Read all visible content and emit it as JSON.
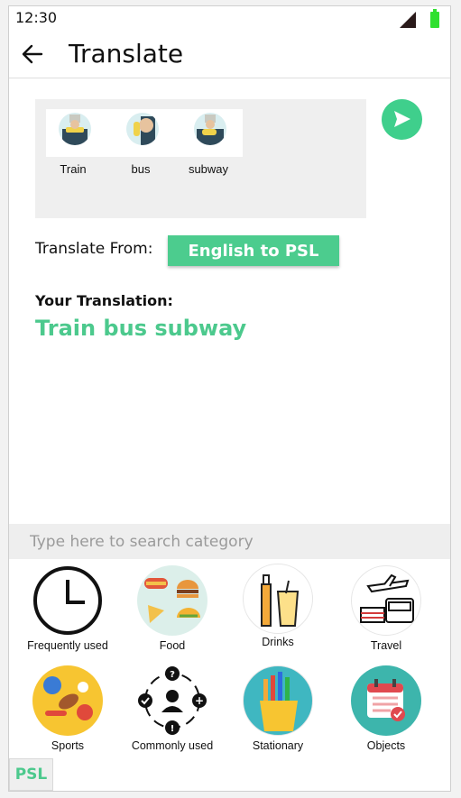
{
  "status_bar": {
    "time": "12:30"
  },
  "app_bar": {
    "title": "Translate"
  },
  "signs": [
    {
      "label": "Train"
    },
    {
      "label": "bus"
    },
    {
      "label": "subway"
    }
  ],
  "translate_from": {
    "label": "Translate From:",
    "button": "English to PSL"
  },
  "translation": {
    "label": "Your Translation:",
    "text": "Train bus subway"
  },
  "search": {
    "placeholder": "Type here to search category"
  },
  "categories": [
    {
      "label": "Frequently used",
      "icon": "clock-icon"
    },
    {
      "label": "Food",
      "icon": "food-icon"
    },
    {
      "label": "Drinks",
      "icon": "drinks-icon"
    },
    {
      "label": "Travel",
      "icon": "travel-icon"
    },
    {
      "label": "Sports",
      "icon": "sports-icon"
    },
    {
      "label": "Commonly used",
      "icon": "person-actions-icon"
    },
    {
      "label": "Stationary",
      "icon": "stationary-icon"
    },
    {
      "label": "Objects",
      "icon": "calendar-icon"
    }
  ],
  "footer": {
    "psl_label": "PSL"
  },
  "colors": {
    "accent": "#4ccc8e",
    "battery": "#2fe02f"
  }
}
